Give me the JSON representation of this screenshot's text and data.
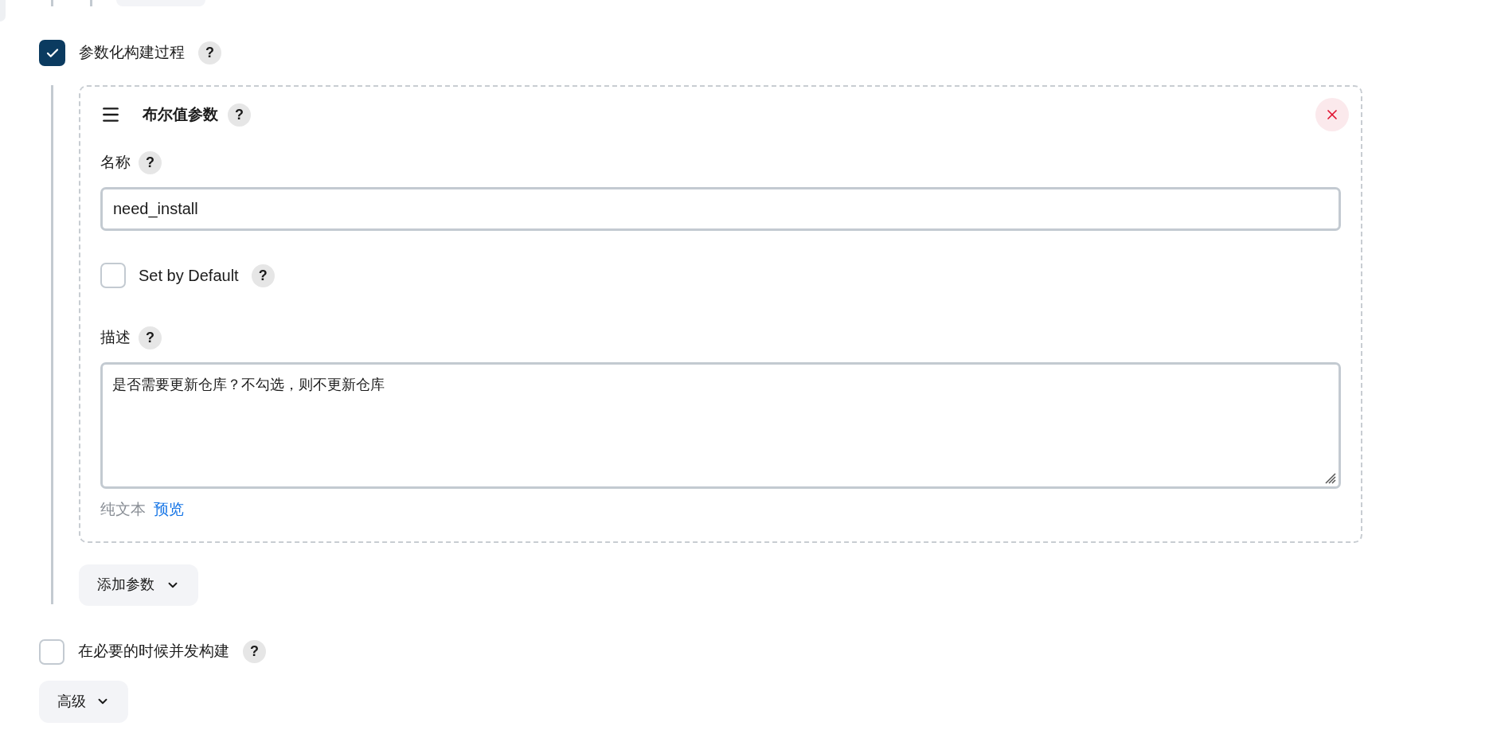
{
  "sections": [
    {
      "kind": "checkbox",
      "label": "参数化构建过程",
      "help": "?",
      "checked": true,
      "parameters": [
        {
          "title": "布尔值参数",
          "help": "?",
          "fields": [
            {
              "kind": "text",
              "label": "名称",
              "help": "?",
              "value": "need_install"
            },
            {
              "kind": "checkbox",
              "label": "Set by Default",
              "help": "?",
              "checked": false
            },
            {
              "kind": "textarea",
              "label": "描述",
              "help": "?",
              "value": "是否需要更新仓库？不勾选，则不更新仓库",
              "format_links": [
                {
                  "label": "纯文本",
                  "selected": true
                },
                {
                  "label": "预览",
                  "selected": false
                }
              ]
            }
          ]
        }
      ],
      "add_button": "添加参数"
    },
    {
      "kind": "checkbox",
      "label": "在必要的时候并发构建",
      "help": "?",
      "checked": false
    }
  ],
  "advanced_button": "高级"
}
